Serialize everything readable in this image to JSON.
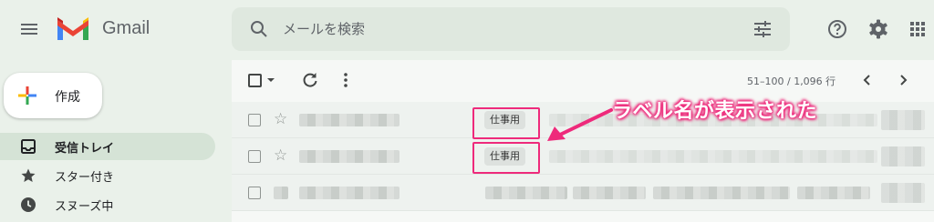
{
  "header": {
    "app_name": "Gmail",
    "search_placeholder": "メールを検索",
    "brand_colors": {
      "red": "#ea4335",
      "blue": "#4285f4",
      "green": "#34a853",
      "yellow": "#fbbc04"
    },
    "icons": [
      "menu-icon",
      "gmail-logo",
      "search-icon",
      "filter-icon",
      "help-icon",
      "gear-icon",
      "apps-icon"
    ]
  },
  "compose": {
    "label": "作成"
  },
  "sidebar": {
    "items": [
      {
        "label": "受信トレイ",
        "icon": "inbox-icon",
        "active": true
      },
      {
        "label": "スター付き",
        "icon": "star-icon",
        "active": false
      },
      {
        "label": "スヌーズ中",
        "icon": "clock-icon",
        "active": false
      }
    ]
  },
  "toolbar": {
    "page_info": "51–100 / 1,096 行",
    "icons": [
      "select-checkbox",
      "select-dropdown-icon",
      "refresh-icon",
      "more-icon",
      "prev-page-icon",
      "next-page-icon"
    ]
  },
  "email_list": {
    "rows": [
      {
        "label": "仕事用",
        "highlighted": true
      },
      {
        "label": "仕事用",
        "highlighted": true
      },
      {
        "label": "",
        "highlighted": false
      }
    ]
  },
  "annotation": {
    "text": "ラベル名が表示された",
    "color": "#ee2a7b"
  }
}
